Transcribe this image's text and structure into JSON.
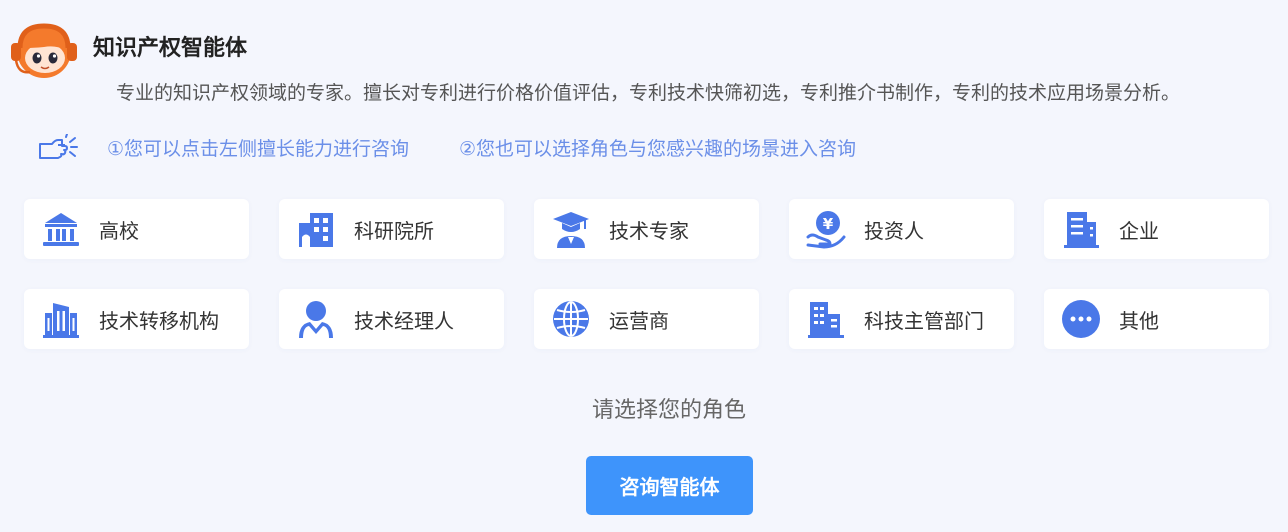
{
  "agent": {
    "name": "知识产权智能体",
    "description": "专业的知识产权领域的专家。擅长对专利进行价格价值评估，专利技术快筛初选，专利推介书制作，专利的技术应用场景分析。"
  },
  "hints": [
    "①您可以点击左侧擅长能力进行咨询",
    "②您也可以选择角色与您感兴趣的场景进入咨询"
  ],
  "roles": [
    {
      "label": "高校",
      "icon": "university-icon"
    },
    {
      "label": "科研院所",
      "icon": "research-institute-icon"
    },
    {
      "label": "技术专家",
      "icon": "graduate-cap-icon"
    },
    {
      "label": "投资人",
      "icon": "yuan-coin-hand-icon"
    },
    {
      "label": "企业",
      "icon": "enterprise-building-icon"
    },
    {
      "label": "技术转移机构",
      "icon": "office-building-icon"
    },
    {
      "label": "技术经理人",
      "icon": "manager-person-icon"
    },
    {
      "label": "运营商",
      "icon": "globe-icon"
    },
    {
      "label": "科技主管部门",
      "icon": "government-building-icon"
    },
    {
      "label": "其他",
      "icon": "more-dots-icon"
    }
  ],
  "prompt": "请选择您的角色",
  "action": {
    "label": "咨询智能体"
  },
  "colors": {
    "icon_blue": "#4a78e8",
    "hint_blue": "#6b8fe8",
    "button_blue": "#3e94fb",
    "avatar_orange": "#f47a2c"
  }
}
